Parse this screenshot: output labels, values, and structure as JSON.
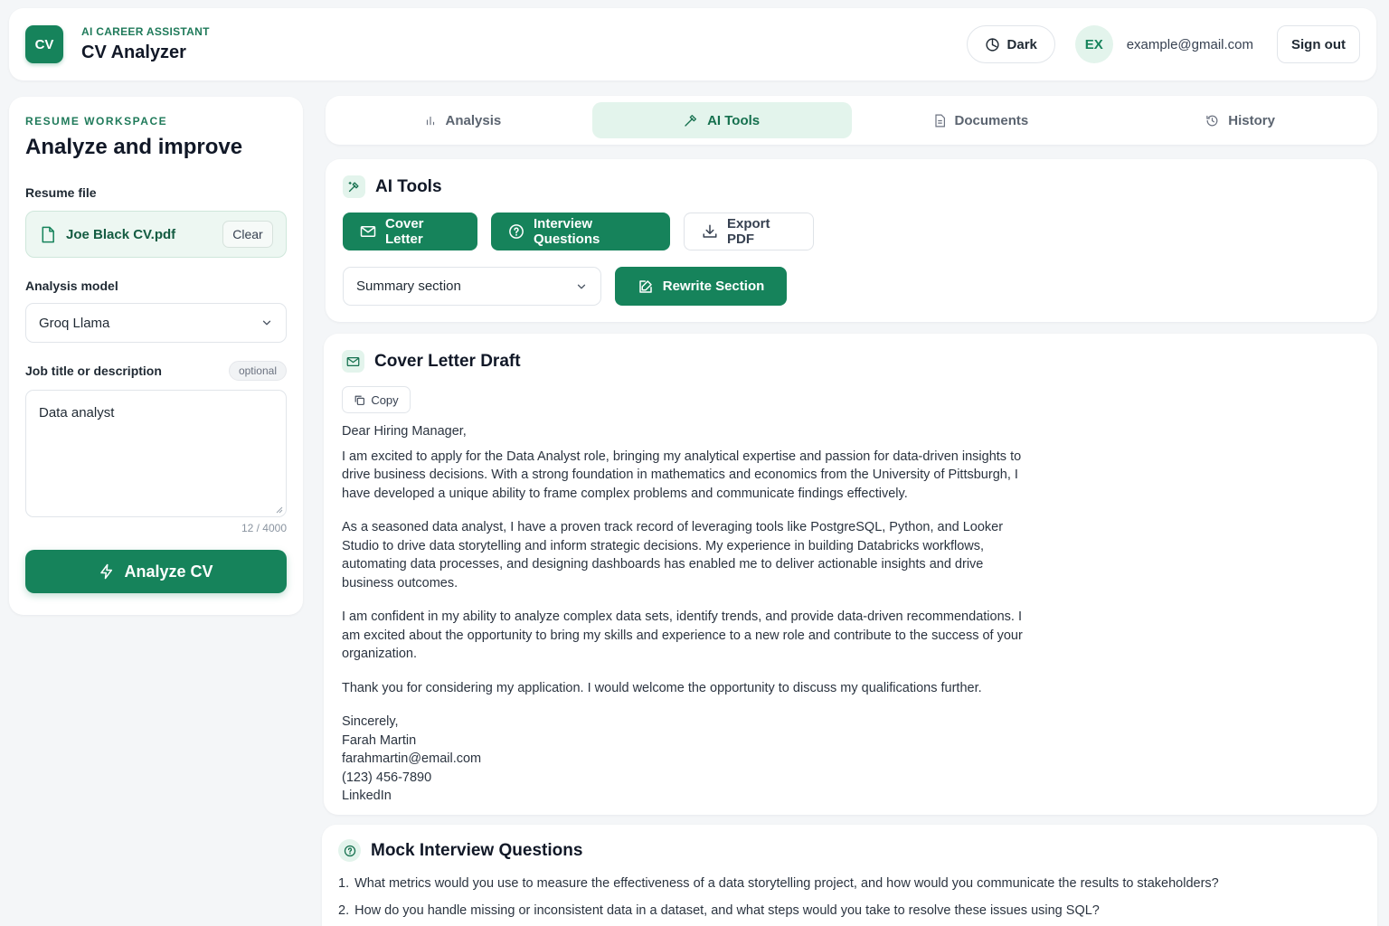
{
  "header": {
    "logo": "CV",
    "kicker": "AI CAREER ASSISTANT",
    "title": "CV Analyzer",
    "theme_label": "Dark",
    "avatar": "EX",
    "email": "example@gmail.com",
    "signout_label": "Sign out"
  },
  "sidebar": {
    "kicker": "RESUME WORKSPACE",
    "title": "Analyze and improve",
    "resume_label": "Resume file",
    "file_name": "Joe Black CV.pdf",
    "clear_label": "Clear",
    "model_label": "Analysis model",
    "model_value": "Groq Llama",
    "job_label": "Job title or description",
    "optional_label": "optional",
    "job_value": "Data analyst",
    "counter": "12 / 4000",
    "analyze_label": "Analyze CV"
  },
  "tabs": [
    {
      "label": "Analysis",
      "icon": "bar-chart-icon"
    },
    {
      "label": "AI Tools",
      "icon": "wand-icon",
      "active": true
    },
    {
      "label": "Documents",
      "icon": "document-icon"
    },
    {
      "label": "History",
      "icon": "history-icon"
    }
  ],
  "tools": {
    "title": "AI Tools",
    "cover_letter_label": "Cover Letter",
    "interview_label": "Interview Questions",
    "export_label": "Export PDF",
    "section_value": "Summary section",
    "rewrite_label": "Rewrite Section"
  },
  "letter": {
    "title": "Cover Letter Draft",
    "copy_label": "Copy",
    "greeting": "Dear Hiring Manager,",
    "paragraphs": [
      "I am excited to apply for the Data Analyst role, bringing my analytical expertise and passion for data-driven insights to drive business decisions. With a strong foundation in mathematics and economics from the University of Pittsburgh, I have developed a unique ability to frame complex problems and communicate findings effectively.",
      "As a seasoned data analyst, I have a proven track record of leveraging tools like PostgreSQL, Python, and Looker Studio to drive data storytelling and inform strategic decisions. My experience in building Databricks workflows, automating data processes, and designing dashboards has enabled me to deliver actionable insights and drive business outcomes.",
      "I am confident in my ability to analyze complex data sets, identify trends, and provide data-driven recommendations. I am excited about the opportunity to bring my skills and experience to a new role and contribute to the success of your organization.",
      "Thank you for considering my application. I would welcome the opportunity to discuss my qualifications further."
    ],
    "signature": [
      "Sincerely,",
      "Farah Martin",
      "farahmartin@email.com",
      "(123) 456-7890",
      "LinkedIn"
    ]
  },
  "interview": {
    "title": "Mock Interview Questions",
    "questions": [
      "What metrics would you use to measure the effectiveness of a data storytelling project, and how would you communicate the results to stakeholders?",
      "How do you handle missing or inconsistent data in a dataset, and what steps would you take to resolve these issues using SQL?"
    ]
  },
  "colors": {
    "accent": "#16835b",
    "accent_soft": "#e3f4ec",
    "background": "#f4f6f8"
  }
}
